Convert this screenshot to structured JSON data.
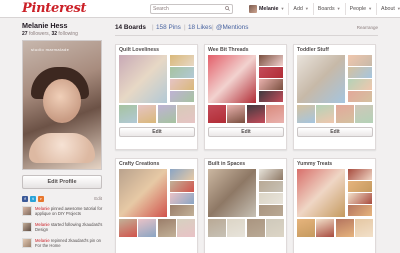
{
  "header": {
    "logo": "Pinterest",
    "search_placeholder": "Search",
    "nav": {
      "user": "Melanie",
      "add": "Add",
      "boards": "Boards",
      "people": "People",
      "about": "About"
    }
  },
  "profile": {
    "name": "Melanie Hess",
    "followers": "27",
    "followers_label": "followers,",
    "following": "32",
    "following_label": "following",
    "photo_brand": "studio marmalade",
    "edit_button": "Edit Profile",
    "social_edit": "Edit",
    "activity": [
      {
        "who": "Melanie",
        "text": "pinned awesome tutorial for applique on DIY Projects"
      },
      {
        "who": "Melanie",
        "text": "started following zkaudard's Design"
      },
      {
        "who": "Melanie",
        "text": "repinned zkaudard's pin on For the Home"
      }
    ]
  },
  "main": {
    "tabs": {
      "boards": "14 Boards",
      "pins": "158 Pins",
      "likes": "18 Likes",
      "mentions": "@Mentions"
    },
    "rearrange": "Rearrange"
  },
  "boards": [
    {
      "title": "Quilt Loveliness",
      "edit": "Edit",
      "colors": [
        "#c8a9b6",
        "#e7d8c5",
        "#b2c9d6",
        "#d9b87a",
        "#a6c3a0",
        "#e6c4c4",
        "#bfb2d4",
        "#d7cbb9"
      ]
    },
    {
      "title": "Wee Bit Threads",
      "edit": "Edit",
      "colors": [
        "#e35f6a",
        "#f2d2cf",
        "#b12c35",
        "#7a4f3f",
        "#c44c5a",
        "#e9b2ae",
        "#403a3f",
        "#d98a7d"
      ]
    },
    {
      "title": "Toddler Stuff",
      "edit": "Edit",
      "colors": [
        "#e9e3dc",
        "#c7b9a8",
        "#a5c5df",
        "#f0c7ae",
        "#d4c1a0",
        "#b4d2b7",
        "#e3a89a",
        "#cfc7b9"
      ]
    },
    {
      "title": "Crafty Creations",
      "edit": "Edit",
      "colors": [
        "#b9a28d",
        "#e7c9a5",
        "#d1534c",
        "#8aa5c4",
        "#c2b198",
        "#e9c2c6",
        "#9b7e6a",
        "#d6d1c0"
      ]
    },
    {
      "title": "Built in Spaces",
      "edit": "Edit",
      "colors": [
        "#cbb7a1",
        "#8e7865",
        "#c7c1b5",
        "#e7e3da",
        "#b9a995",
        "#dcd5c6",
        "#aa9580",
        "#cfc9bb"
      ]
    },
    {
      "title": "Yummy Treats",
      "edit": "Edit",
      "colors": [
        "#d86f6b",
        "#efd6c5",
        "#c59a5f",
        "#a84b3e",
        "#e6b47d",
        "#f2e0c9",
        "#b5755f",
        "#e5c7a3"
      ]
    }
  ],
  "colors": {
    "brand_red": "#cb2027",
    "link_blue": "#4863a0",
    "facebook": "#3b5998",
    "twitter": "#2aa3d8",
    "rss": "#e8772e"
  },
  "icons": {
    "search": "search-icon",
    "caret": "chevron-down-icon",
    "facebook": "facebook-icon",
    "twitter": "twitter-icon",
    "rss": "rss-icon"
  }
}
